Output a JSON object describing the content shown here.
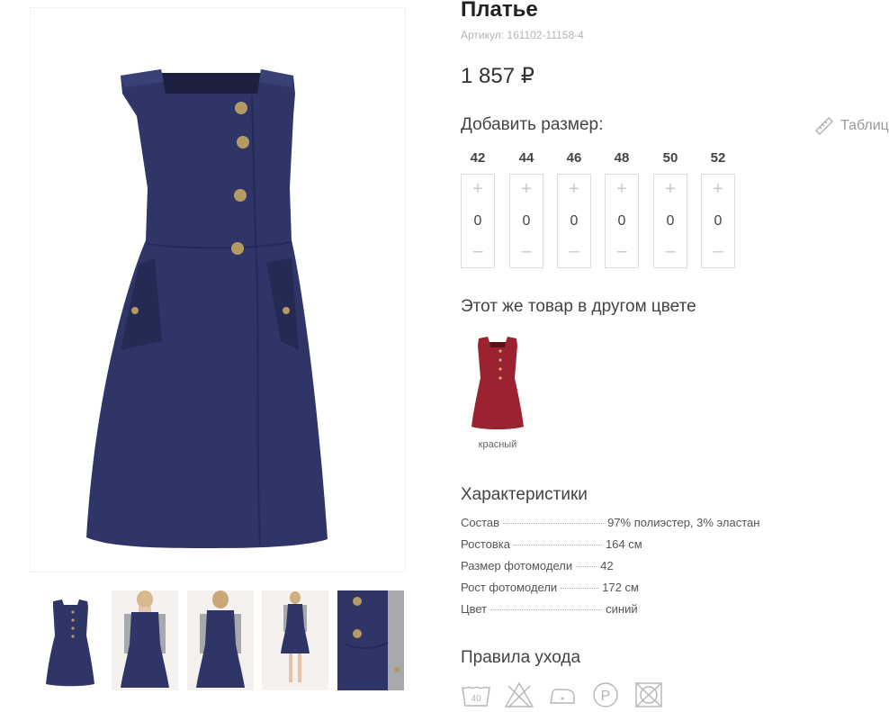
{
  "product": {
    "title": "Платье",
    "sku": "Артикул: 161102-11158-4",
    "price": "1 857 ₽"
  },
  "sizes": {
    "heading": "Добавить размер:",
    "table_link": "Таблиц",
    "items": [
      {
        "size": "42",
        "plus": "+",
        "qty": "0",
        "minus": "–"
      },
      {
        "size": "44",
        "plus": "+",
        "qty": "0",
        "minus": "–"
      },
      {
        "size": "46",
        "plus": "+",
        "qty": "0",
        "minus": "–"
      },
      {
        "size": "48",
        "plus": "+",
        "qty": "0",
        "minus": "–"
      },
      {
        "size": "50",
        "plus": "+",
        "qty": "0",
        "minus": "–"
      },
      {
        "size": "52",
        "plus": "+",
        "qty": "0",
        "minus": "–"
      }
    ]
  },
  "other_colors": {
    "heading": "Этот же товар в другом цвете",
    "items": [
      {
        "label": "красный",
        "color": "#9b2230"
      }
    ]
  },
  "characteristics": {
    "heading": "Характеристики",
    "rows": [
      {
        "key": "Состав",
        "value": "97% полиэстер, 3% эластан"
      },
      {
        "key": "Ростовка",
        "value": "164 см"
      },
      {
        "key": "Размер фотомодели",
        "value": "42"
      },
      {
        "key": "Рост фотомодели",
        "value": "172 см"
      },
      {
        "key": "Цвет",
        "value": "синий"
      }
    ]
  },
  "care": {
    "heading": "Правила ухода",
    "icons": [
      {
        "name": "wash-40-icon",
        "text": "40"
      },
      {
        "name": "no-bleach-icon"
      },
      {
        "name": "iron-low-icon"
      },
      {
        "name": "dry-clean-p-icon",
        "text": "P"
      },
      {
        "name": "no-tumble-dry-icon"
      }
    ]
  },
  "colors": {
    "dress_navy": "#2f3567",
    "accent_teal": "#3bbfae",
    "button_gold": "#b59a62"
  }
}
